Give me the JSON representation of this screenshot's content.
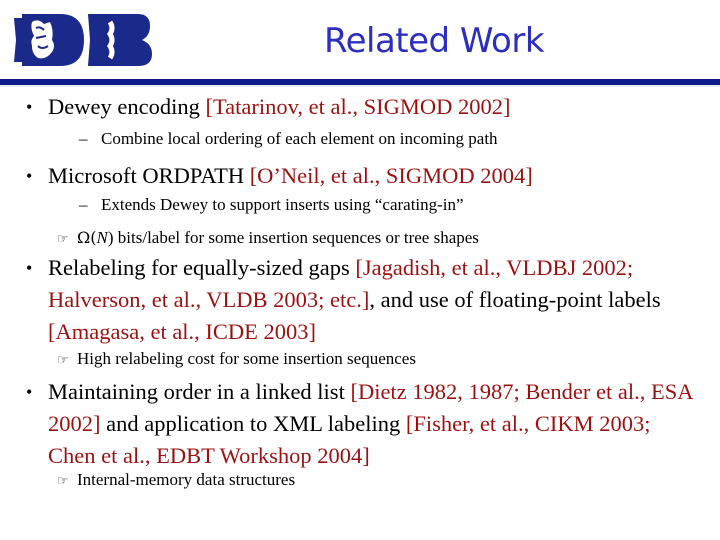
{
  "logo": {
    "alt": "Duke DB logo",
    "letters": "DB",
    "color": "#1b2a8a"
  },
  "title": "Related Work",
  "colors": {
    "title": "#2b2ebf",
    "rule": "#0d1a8c",
    "citation": "#9b1111"
  },
  "items": [
    {
      "text": "Dewey encoding ",
      "cite": "[Tatarinov, et al., SIGMOD 2002]",
      "sub": [
        {
          "marker": "–",
          "text": "Combine local ordering of each element on incoming path"
        }
      ]
    },
    {
      "text": "Microsoft ORDPATH ",
      "cite": "[O’Neil, et al., SIGMOD 2004]",
      "sub": [
        {
          "marker": "–",
          "text": "Extends Dewey to support inserts using “carating-in”"
        },
        {
          "marker": "☞",
          "omega": "Ω(",
          "n": "N",
          "omega_close": ")",
          "text": " bits/label for some insertion sequences or tree shapes"
        }
      ]
    },
    {
      "text": "Relabeling for equally-sized gaps ",
      "cite": "[Jagadish, et al., VLDBJ 2002; Halverson, et al., VLDB 2003; etc.]",
      "text2": ", and use of floating-point labels ",
      "cite2": "[Amagasa, et al., ICDE 2003]",
      "sub": [
        {
          "marker": "☞",
          "text": "High relabeling cost for some insertion sequences"
        }
      ]
    },
    {
      "text": "Maintaining order in a linked list ",
      "cite": "[Dietz 1982, 1987; Bender et al., ESA 2002]",
      "text2": " and application to XML labeling ",
      "cite2": "[Fisher, et al., CIKM 2003; Chen et al., EDBT Workshop 2004]",
      "sub": [
        {
          "marker": "☞",
          "text": "Internal-memory data structures"
        }
      ]
    }
  ]
}
